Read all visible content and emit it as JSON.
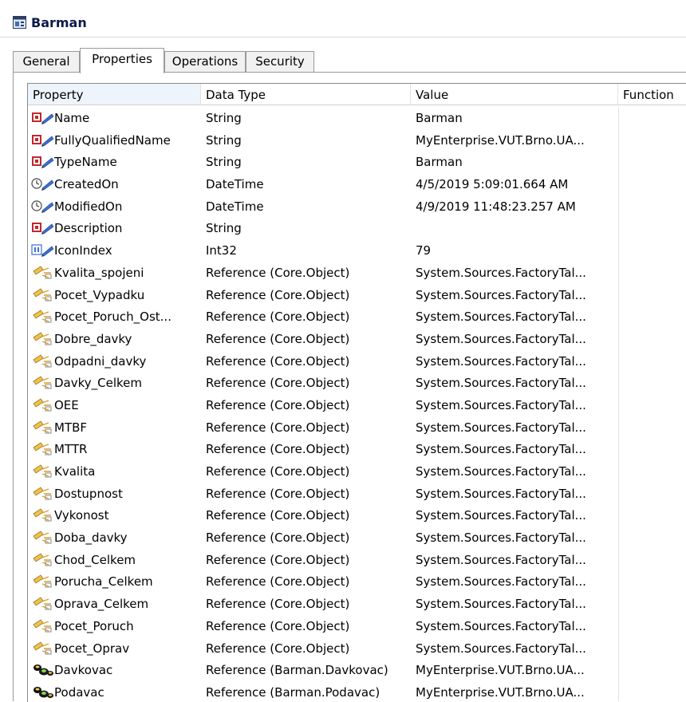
{
  "window": {
    "title": "Barman",
    "icon": "class-icon"
  },
  "tabs": [
    {
      "label": "General",
      "active": false
    },
    {
      "label": "Properties",
      "active": true
    },
    {
      "label": "Operations",
      "active": false
    },
    {
      "label": "Security",
      "active": false
    }
  ],
  "table": {
    "columns": [
      "Property",
      "Data Type",
      "Value",
      "Function"
    ],
    "rows": [
      {
        "icon": "string-attribute-icon",
        "property": "Name",
        "type": "String",
        "value": "Barman"
      },
      {
        "icon": "string-attribute-icon",
        "property": "FullyQualifiedName",
        "type": "String",
        "value": "MyEnterprise.VUT.Brno.UA..."
      },
      {
        "icon": "string-attribute-icon",
        "property": "TypeName",
        "type": "String",
        "value": "Barman"
      },
      {
        "icon": "datetime-attribute-icon",
        "property": "CreatedOn",
        "type": "DateTime",
        "value": "4/5/2019 5:09:01.664 AM"
      },
      {
        "icon": "datetime-attribute-icon",
        "property": "ModifiedOn",
        "type": "DateTime",
        "value": "4/9/2019 11:48:23.257 AM"
      },
      {
        "icon": "string-attribute-icon",
        "property": "Description",
        "type": "String",
        "value": ""
      },
      {
        "icon": "integer-attribute-icon",
        "property": "IconIndex",
        "type": "Int32",
        "value": "79"
      },
      {
        "icon": "reference-icon",
        "property": "Kvalita_spojeni",
        "type": "Reference (Core.Object)",
        "value": "System.Sources.FactoryTal..."
      },
      {
        "icon": "reference-icon",
        "property": "Pocet_Vypadku",
        "type": "Reference (Core.Object)",
        "value": "System.Sources.FactoryTal..."
      },
      {
        "icon": "reference-icon",
        "property": "Pocet_Poruch_Ost...",
        "type": "Reference (Core.Object)",
        "value": "System.Sources.FactoryTal..."
      },
      {
        "icon": "reference-icon",
        "property": "Dobre_davky",
        "type": "Reference (Core.Object)",
        "value": "System.Sources.FactoryTal..."
      },
      {
        "icon": "reference-icon",
        "property": "Odpadni_davky",
        "type": "Reference (Core.Object)",
        "value": "System.Sources.FactoryTal..."
      },
      {
        "icon": "reference-icon",
        "property": "Davky_Celkem",
        "type": "Reference (Core.Object)",
        "value": "System.Sources.FactoryTal..."
      },
      {
        "icon": "reference-icon",
        "property": "OEE",
        "type": "Reference (Core.Object)",
        "value": "System.Sources.FactoryTal..."
      },
      {
        "icon": "reference-icon",
        "property": "MTBF",
        "type": "Reference (Core.Object)",
        "value": "System.Sources.FactoryTal..."
      },
      {
        "icon": "reference-icon",
        "property": "MTTR",
        "type": "Reference (Core.Object)",
        "value": "System.Sources.FactoryTal..."
      },
      {
        "icon": "reference-icon",
        "property": "Kvalita",
        "type": "Reference (Core.Object)",
        "value": "System.Sources.FactoryTal..."
      },
      {
        "icon": "reference-icon",
        "property": "Dostupnost",
        "type": "Reference (Core.Object)",
        "value": "System.Sources.FactoryTal..."
      },
      {
        "icon": "reference-icon",
        "property": "Vykonost",
        "type": "Reference (Core.Object)",
        "value": "System.Sources.FactoryTal..."
      },
      {
        "icon": "reference-icon",
        "property": "Doba_davky",
        "type": "Reference (Core.Object)",
        "value": "System.Sources.FactoryTal..."
      },
      {
        "icon": "reference-icon",
        "property": "Chod_Celkem",
        "type": "Reference (Core.Object)",
        "value": "System.Sources.FactoryTal..."
      },
      {
        "icon": "reference-icon",
        "property": "Porucha_Celkem",
        "type": "Reference (Core.Object)",
        "value": "System.Sources.FactoryTal..."
      },
      {
        "icon": "reference-icon",
        "property": "Oprava_Celkem",
        "type": "Reference (Core.Object)",
        "value": "System.Sources.FactoryTal..."
      },
      {
        "icon": "reference-icon",
        "property": "Pocet_Poruch",
        "type": "Reference (Core.Object)",
        "value": "System.Sources.FactoryTal..."
      },
      {
        "icon": "reference-icon",
        "property": "Pocet_Oprav",
        "type": "Reference (Core.Object)",
        "value": "System.Sources.FactoryTal..."
      },
      {
        "icon": "contained-object-icon",
        "property": "Davkovac",
        "type": "Reference (Barman.Davkovac)",
        "value": "MyEnterprise.VUT.Brno.UA..."
      },
      {
        "icon": "contained-object-icon",
        "property": "Podavac",
        "type": "Reference (Barman.Podavac)",
        "value": "MyEnterprise.VUT.Brno.UA..."
      }
    ]
  }
}
